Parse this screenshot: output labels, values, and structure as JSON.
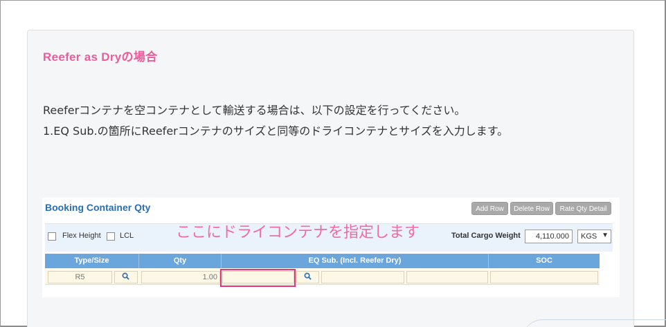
{
  "article": {
    "heading": "Reefer as Dryの場合",
    "paragraph_1": "Reeferコンテナを空コンテナとして輸送する場合は、以下の設定を行ってください。",
    "paragraph_2": "1.EQ Sub.の箇所にReeferコンテナのサイズと同等のドライコンテナとサイズを入力します。"
  },
  "screenshot": {
    "title": "Booking Container Qty",
    "buttons": {
      "add_row": "Add Row",
      "delete_row": "Delete Row",
      "rate_qty_detail": "Rate Qty Detail"
    },
    "options": {
      "flex_height": "Flex Height",
      "lcl": "LCL"
    },
    "annotation": "ここにドライコンテナを指定します",
    "gross_weight": {
      "label": "Total Cargo Weight",
      "value": "4,110.000",
      "unit": "KGS"
    },
    "table": {
      "columns": [
        "Type/Size",
        "Qty",
        "EQ Sub. (Incl. Reefer Dry)",
        "SOC"
      ],
      "row": {
        "type_size": "R5",
        "qty": "1.00",
        "eq_sub": ""
      }
    },
    "icons": {
      "search": "magnifier-icon",
      "dropdown": "chevron-down-icon"
    }
  }
}
